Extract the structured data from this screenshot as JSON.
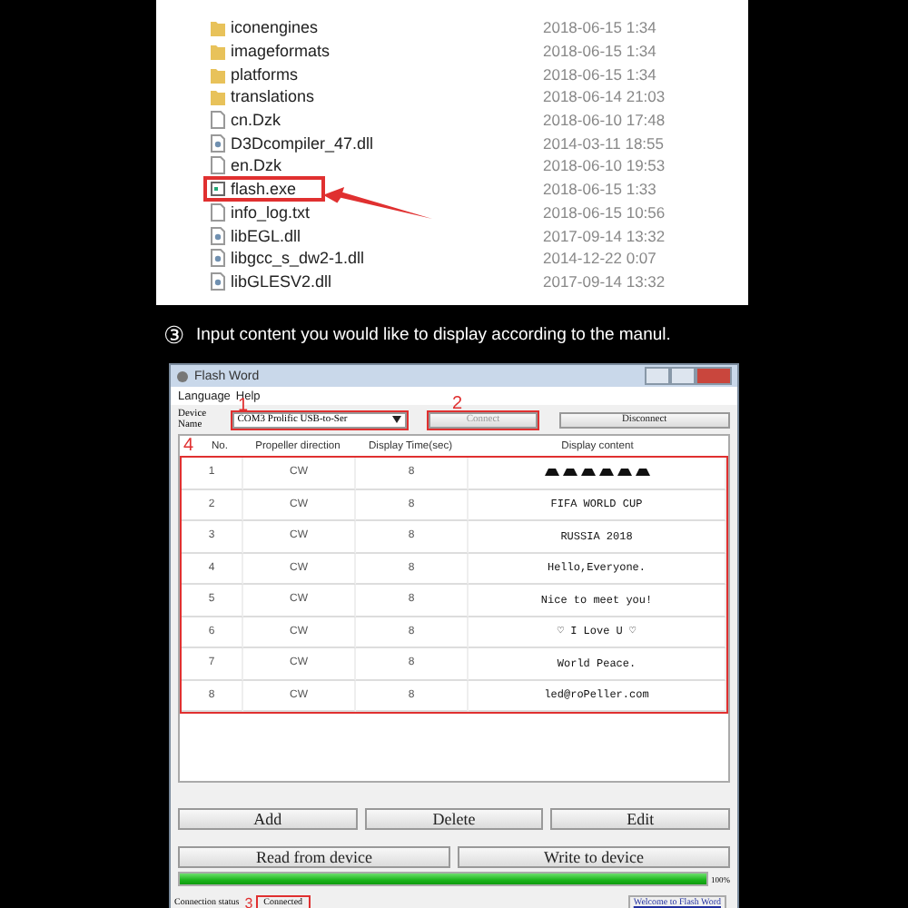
{
  "explorer": {
    "files": [
      {
        "name": "iconengines",
        "date": "2018-06-15 1:34",
        "kind": "folder",
        "highlighted": false
      },
      {
        "name": "imageformats",
        "date": "2018-06-15 1:34",
        "kind": "folder",
        "highlighted": false
      },
      {
        "name": "platforms",
        "date": "2018-06-15 1:34",
        "kind": "folder",
        "highlighted": false
      },
      {
        "name": "translations",
        "date": "2018-06-14 21:03",
        "kind": "folder",
        "highlighted": false
      },
      {
        "name": "cn.Dzk",
        "date": "2018-06-10 17:48",
        "kind": "file",
        "highlighted": false
      },
      {
        "name": "D3Dcompiler_47.dll",
        "date": "2014-03-11 18:55",
        "kind": "dll",
        "highlighted": false
      },
      {
        "name": "en.Dzk",
        "date": "2018-06-10 19:53",
        "kind": "file",
        "highlighted": false
      },
      {
        "name": "flash.exe",
        "date": "2018-06-15 1:33",
        "kind": "exe",
        "highlighted": true
      },
      {
        "name": "info_log.txt",
        "date": "2018-06-15 10:56",
        "kind": "file",
        "highlighted": false
      },
      {
        "name": "libEGL.dll",
        "date": "2017-09-14 13:32",
        "kind": "dll",
        "highlighted": false
      },
      {
        "name": "libgcc_s_dw2-1.dll",
        "date": "2014-12-22 0:07",
        "kind": "dll",
        "highlighted": false
      },
      {
        "name": "libGLESV2.dll",
        "date": "2017-09-14 13:32",
        "kind": "dll",
        "highlighted": false
      }
    ]
  },
  "step": {
    "number": "③",
    "text": "Input content you would like to display according to the manul."
  },
  "window": {
    "title": "Flash Word",
    "menu": [
      "Language",
      "Help"
    ],
    "device_label": "Device Name",
    "device_value": "COM3 Prolific USB-to-Ser",
    "device_callout": "1",
    "connect": "Connect",
    "connect_disabled": true,
    "connect_callout": "2",
    "disconnect": "Disconnect",
    "table": {
      "callout": "4",
      "columns": [
        "No.",
        "Propeller direction",
        "Display Time(sec)",
        "Display content"
      ],
      "rows": [
        {
          "no": "1",
          "direction": "CW",
          "time": "8",
          "kind": "symbols"
        },
        {
          "no": "2",
          "direction": "CW",
          "time": "8",
          "kind": "text",
          "content": "FIFA WORLD CUP"
        },
        {
          "no": "3",
          "direction": "CW",
          "time": "8",
          "kind": "text",
          "content": "RUSSIA 2018"
        },
        {
          "no": "4",
          "direction": "CW",
          "time": "8",
          "kind": "text",
          "content": "Hello,Everyone."
        },
        {
          "no": "5",
          "direction": "CW",
          "time": "8",
          "kind": "text",
          "content": "Nice to meet you!"
        },
        {
          "no": "6",
          "direction": "CW",
          "time": "8",
          "kind": "text",
          "content": "♡ I Love U ♡"
        },
        {
          "no": "7",
          "direction": "CW",
          "time": "8",
          "kind": "text",
          "content": "World Peace."
        },
        {
          "no": "8",
          "direction": "CW",
          "time": "8",
          "kind": "text",
          "content": "led@roPeller.com"
        }
      ]
    },
    "buttons": [
      "Add",
      "Delete",
      "Edit"
    ],
    "device_buttons": [
      "Read from device",
      "Write to device"
    ],
    "progress": {
      "level": 1,
      "reading": "100%"
    },
    "status_label": "Connection status",
    "status_value": "Connected",
    "status_callout": "3",
    "welcome_link": "Welcome to Flash Word"
  }
}
